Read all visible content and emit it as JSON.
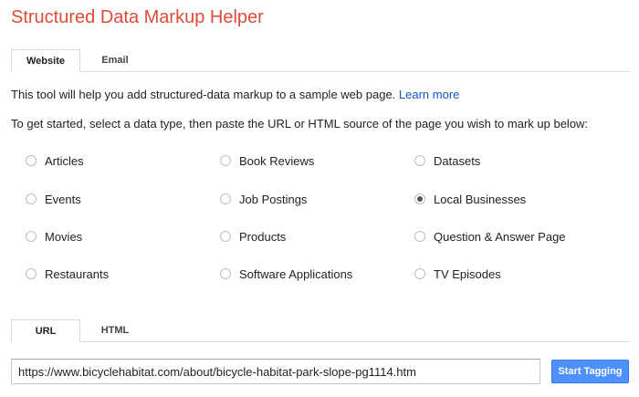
{
  "app": {
    "title": "Structured Data Markup Helper"
  },
  "top_tabs": [
    {
      "label": "Website",
      "active": true
    },
    {
      "label": "Email",
      "active": false
    }
  ],
  "intro": {
    "text": "This tool will help you add structured-data markup to a sample web page.",
    "link_label": "Learn more"
  },
  "instruction": "To get started, select a data type, then paste the URL or HTML source of the page you wish to mark up below:",
  "data_types": [
    {
      "label": "Articles",
      "checked": false
    },
    {
      "label": "Book Reviews",
      "checked": false
    },
    {
      "label": "Datasets",
      "checked": false
    },
    {
      "label": "Events",
      "checked": false
    },
    {
      "label": "Job Postings",
      "checked": false
    },
    {
      "label": "Local Businesses",
      "checked": true
    },
    {
      "label": "Movies",
      "checked": false
    },
    {
      "label": "Products",
      "checked": false
    },
    {
      "label": "Question & Answer Page",
      "checked": false
    },
    {
      "label": "Restaurants",
      "checked": false
    },
    {
      "label": "Software Applications",
      "checked": false
    },
    {
      "label": "TV Episodes",
      "checked": false
    }
  ],
  "source_tabs": [
    {
      "label": "URL",
      "active": true
    },
    {
      "label": "HTML",
      "active": false
    }
  ],
  "url_input": {
    "value": "https://www.bicyclehabitat.com/about/bicycle-habitat-park-slope-pg1114.htm"
  },
  "start_button": {
    "label": "Start Tagging"
  },
  "colors": {
    "title": "#dd4b39",
    "link": "#1155cc",
    "button": "#4d90fe"
  }
}
